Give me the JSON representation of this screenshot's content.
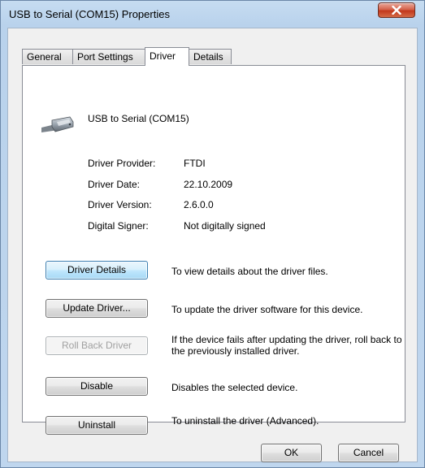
{
  "window": {
    "title": "USB to Serial (COM15) Properties",
    "close_icon": "close-icon"
  },
  "tabs": [
    {
      "label": "General",
      "active": false
    },
    {
      "label": "Port Settings",
      "active": false
    },
    {
      "label": "Driver",
      "active": true
    },
    {
      "label": "Details",
      "active": false
    }
  ],
  "device": {
    "icon": "usb-serial-connector-icon",
    "name": "USB to Serial (COM15)"
  },
  "driver_info": [
    {
      "label": "Driver Provider:",
      "value": "FTDI"
    },
    {
      "label": "Driver Date:",
      "value": "22.10.2009"
    },
    {
      "label": "Driver Version:",
      "value": "2.6.0.0"
    },
    {
      "label": "Digital Signer:",
      "value": "Not digitally signed"
    }
  ],
  "actions": [
    {
      "button": "Driver Details",
      "description": "To view details about the driver files.",
      "enabled": true,
      "focused": true
    },
    {
      "button": "Update Driver...",
      "description": "To update the driver software for this device.",
      "enabled": true
    },
    {
      "button": "Roll Back Driver",
      "description": "If the device fails after updating the driver, roll back to the previously installed driver.",
      "enabled": false
    },
    {
      "button": "Disable",
      "description": "Disables the selected device.",
      "enabled": true
    },
    {
      "button": "Uninstall",
      "description": "To uninstall the driver (Advanced).",
      "enabled": true
    }
  ],
  "footer": {
    "ok_label": "OK",
    "cancel_label": "Cancel"
  }
}
